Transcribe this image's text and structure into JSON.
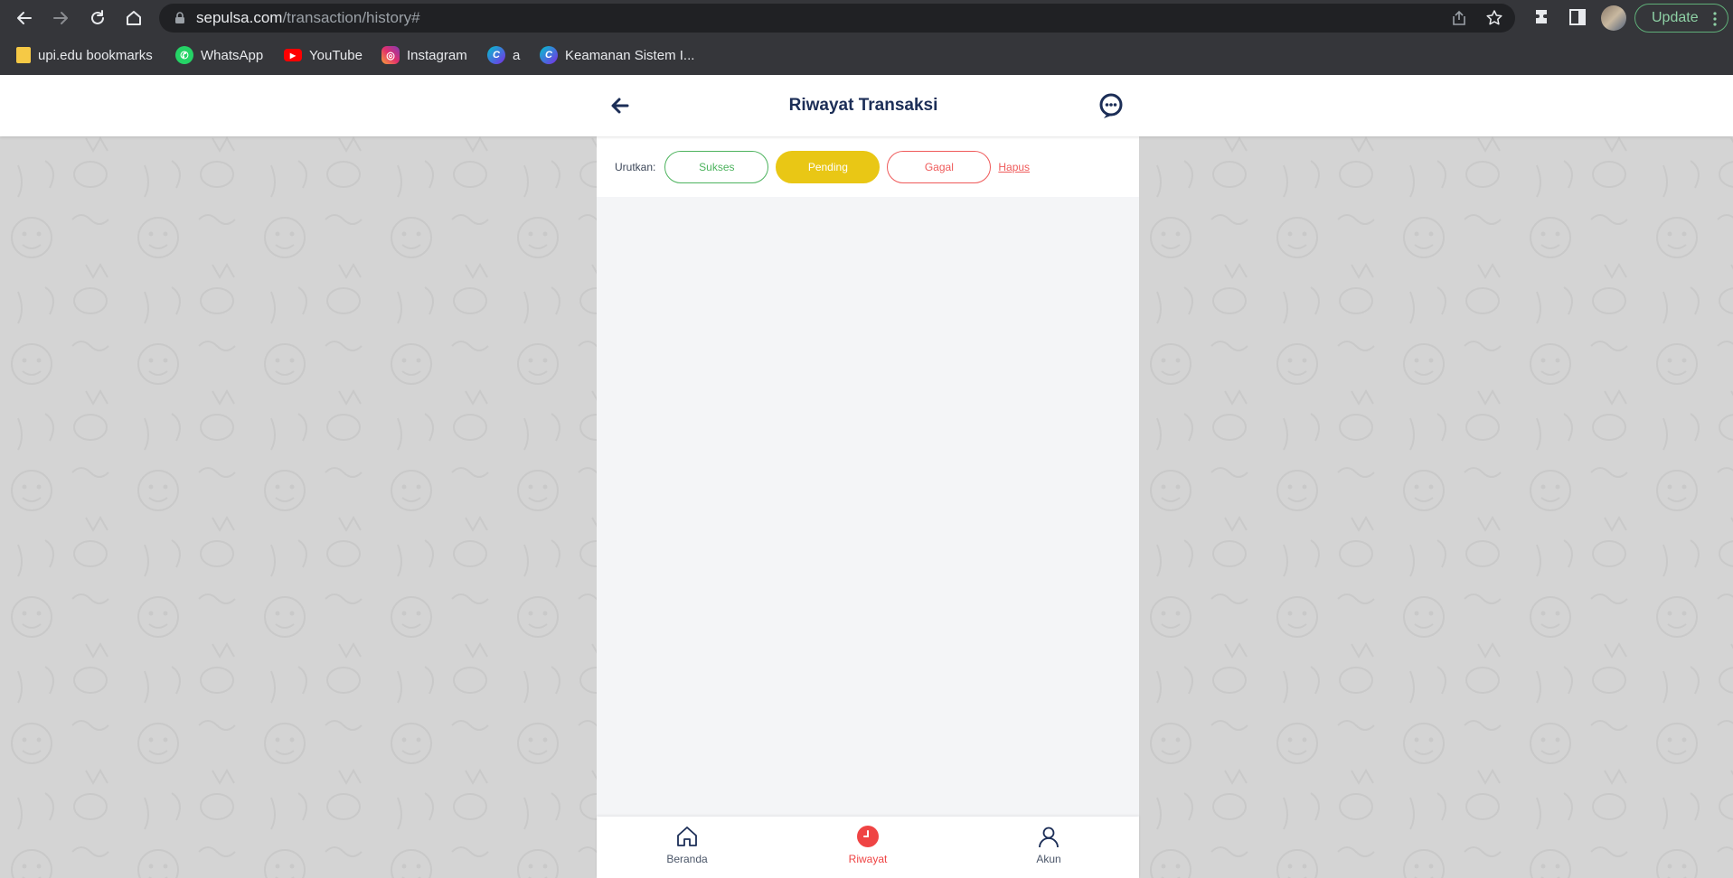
{
  "browser": {
    "url_domain": "sepulsa.com",
    "url_path": "/transaction/history#",
    "update_label": "Update",
    "bookmarks": [
      {
        "label": "upi.edu bookmarks",
        "icon": "folder-icon"
      },
      {
        "label": "WhatsApp",
        "icon": "whatsapp-icon"
      },
      {
        "label": "YouTube",
        "icon": "youtube-icon"
      },
      {
        "label": "Instagram",
        "icon": "instagram-icon"
      },
      {
        "label": "a",
        "icon": "canva-icon"
      },
      {
        "label": "Keamanan Sistem I...",
        "icon": "canva-icon"
      }
    ]
  },
  "header": {
    "title": "Riwayat Transaksi"
  },
  "filter": {
    "label": "Urutkan:",
    "options": [
      "Sukses",
      "Pending",
      "Gagal"
    ],
    "selected": "Pending",
    "clear_label": "Hapus"
  },
  "bottom_nav": {
    "items": [
      {
        "label": "Beranda",
        "icon": "home-icon"
      },
      {
        "label": "Riwayat",
        "icon": "clock-icon"
      },
      {
        "label": "Akun",
        "icon": "user-icon"
      }
    ],
    "active": "Riwayat"
  },
  "colors": {
    "brand_navy": "#1c2e57",
    "success": "#4db35e",
    "pending": "#e9c715",
    "failed": "#ef5a5a"
  }
}
